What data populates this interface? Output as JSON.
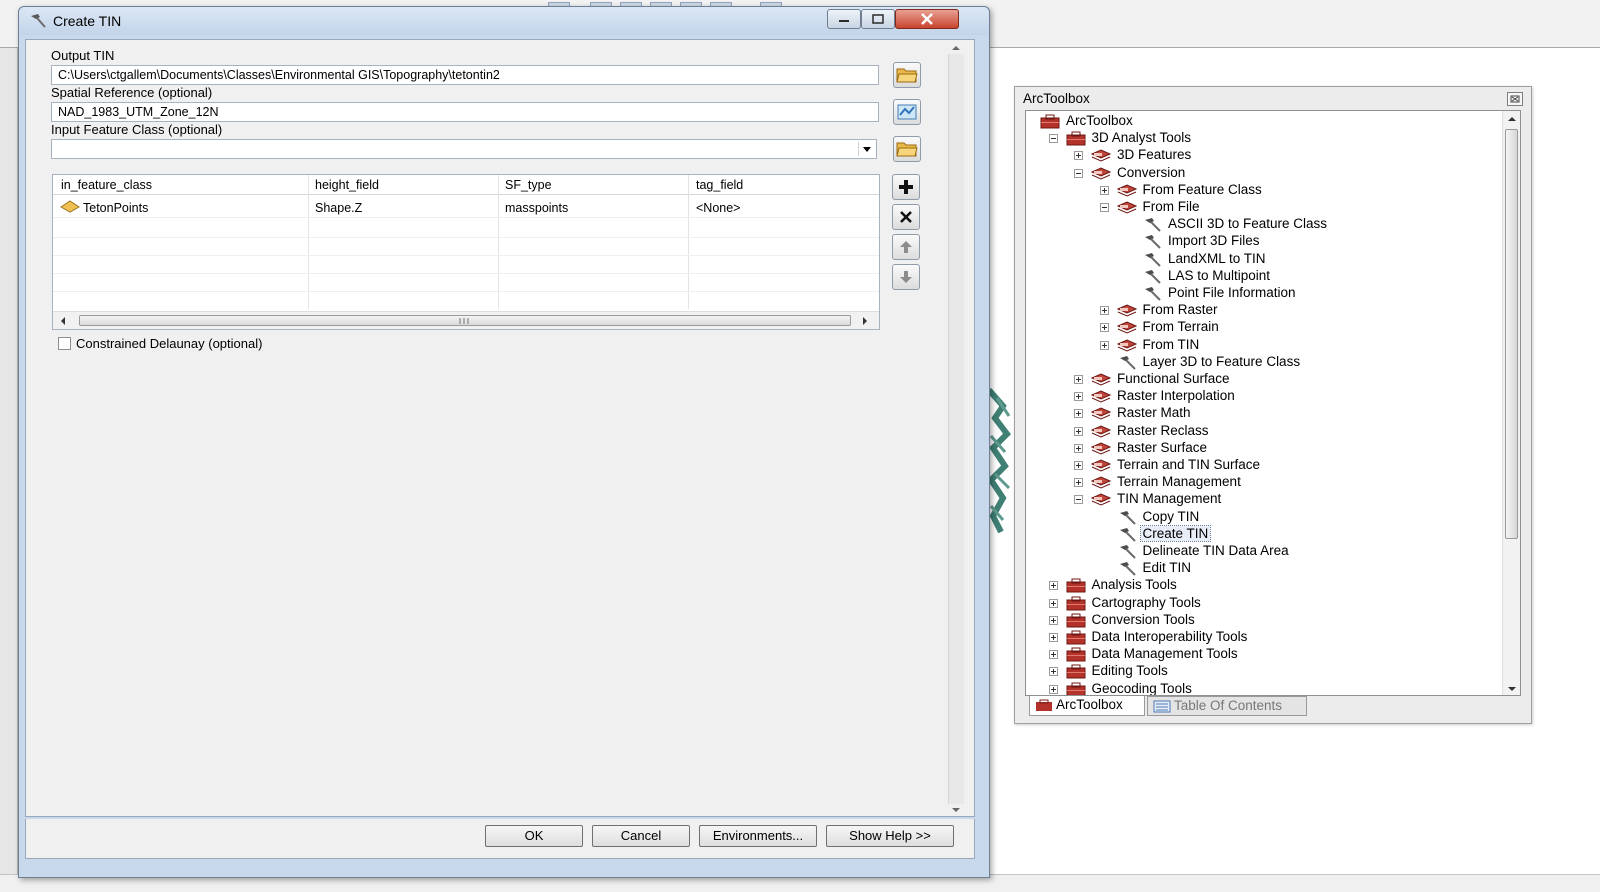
{
  "dialog": {
    "title": "Create TIN",
    "output_tin_label": "Output TIN",
    "output_tin_value": "C:\\Users\\ctgallem\\Documents\\Classes\\Environmental GIS\\Topography\\tetontin2",
    "spatial_ref_label": "Spatial Reference (optional)",
    "spatial_ref_value": "NAD_1983_UTM_Zone_12N",
    "input_fc_label": "Input Feature Class (optional)",
    "input_fc_value": "",
    "table": {
      "headers": [
        "in_feature_class",
        "height_field",
        "SF_type",
        "tag_field"
      ],
      "rows": [
        [
          "TetonPoints",
          "Shape.Z",
          "masspoints",
          "<None>"
        ]
      ]
    },
    "constrained_delaunay_label": "Constrained Delaunay (optional)",
    "constrained_delaunay_checked": false,
    "buttons": {
      "ok": "OK",
      "cancel": "Cancel",
      "environments": "Environments...",
      "show_help": "Show Help >>"
    }
  },
  "toolbox": {
    "title": "ArcToolbox",
    "tree": [
      {
        "label": "ArcToolbox",
        "level": 0,
        "icon": "toolbox-icon",
        "expander": "none"
      },
      {
        "label": "3D Analyst Tools",
        "level": 1,
        "icon": "toolbox-icon",
        "expander": "minus"
      },
      {
        "label": "3D Features",
        "level": 2,
        "icon": "toolset-icon",
        "expander": "plus"
      },
      {
        "label": "Conversion",
        "level": 2,
        "icon": "toolset-icon",
        "expander": "minus"
      },
      {
        "label": "From Feature Class",
        "level": 3,
        "icon": "toolset-icon",
        "expander": "plus"
      },
      {
        "label": "From File",
        "level": 3,
        "icon": "toolset-icon",
        "expander": "minus"
      },
      {
        "label": "ASCII 3D to Feature Class",
        "level": 4,
        "icon": "hammer-icon",
        "expander": "none"
      },
      {
        "label": "Import 3D Files",
        "level": 4,
        "icon": "hammer-icon",
        "expander": "none"
      },
      {
        "label": "LandXML to TIN",
        "level": 4,
        "icon": "hammer-icon",
        "expander": "none"
      },
      {
        "label": "LAS to Multipoint",
        "level": 4,
        "icon": "hammer-icon",
        "expander": "none"
      },
      {
        "label": "Point File Information",
        "level": 4,
        "icon": "hammer-icon",
        "expander": "none"
      },
      {
        "label": "From Raster",
        "level": 3,
        "icon": "toolset-icon",
        "expander": "plus"
      },
      {
        "label": "From Terrain",
        "level": 3,
        "icon": "toolset-icon",
        "expander": "plus"
      },
      {
        "label": "From TIN",
        "level": 3,
        "icon": "toolset-icon",
        "expander": "plus"
      },
      {
        "label": "Layer 3D to Feature Class",
        "level": 3,
        "icon": "hammer-icon",
        "expander": "none"
      },
      {
        "label": "Functional Surface",
        "level": 2,
        "icon": "toolset-icon",
        "expander": "plus"
      },
      {
        "label": "Raster Interpolation",
        "level": 2,
        "icon": "toolset-icon",
        "expander": "plus"
      },
      {
        "label": "Raster Math",
        "level": 2,
        "icon": "toolset-icon",
        "expander": "plus"
      },
      {
        "label": "Raster Reclass",
        "level": 2,
        "icon": "toolset-icon",
        "expander": "plus"
      },
      {
        "label": "Raster Surface",
        "level": 2,
        "icon": "toolset-icon",
        "expander": "plus"
      },
      {
        "label": "Terrain and TIN Surface",
        "level": 2,
        "icon": "toolset-icon",
        "expander": "plus"
      },
      {
        "label": "Terrain Management",
        "level": 2,
        "icon": "toolset-icon",
        "expander": "plus"
      },
      {
        "label": "TIN Management",
        "level": 2,
        "icon": "toolset-icon",
        "expander": "minus"
      },
      {
        "label": "Copy TIN",
        "level": 3,
        "icon": "hammer-icon",
        "expander": "none"
      },
      {
        "label": "Create TIN",
        "level": 3,
        "icon": "hammer-icon",
        "expander": "none",
        "selected": true
      },
      {
        "label": "Delineate TIN Data Area",
        "level": 3,
        "icon": "hammer-icon",
        "expander": "none"
      },
      {
        "label": "Edit TIN",
        "level": 3,
        "icon": "hammer-icon",
        "expander": "none"
      },
      {
        "label": "Analysis Tools",
        "level": 1,
        "icon": "toolbox-icon",
        "expander": "plus"
      },
      {
        "label": "Cartography Tools",
        "level": 1,
        "icon": "toolbox-icon",
        "expander": "plus"
      },
      {
        "label": "Conversion Tools",
        "level": 1,
        "icon": "toolbox-icon",
        "expander": "plus"
      },
      {
        "label": "Data Interoperability Tools",
        "level": 1,
        "icon": "toolbox-icon",
        "expander": "plus"
      },
      {
        "label": "Data Management Tools",
        "level": 1,
        "icon": "toolbox-icon",
        "expander": "plus"
      },
      {
        "label": "Editing Tools",
        "level": 1,
        "icon": "toolbox-icon",
        "expander": "plus"
      },
      {
        "label": "Geocoding Tools",
        "level": 1,
        "icon": "toolbox-icon",
        "expander": "plus"
      }
    ],
    "tabs": [
      "ArcToolbox",
      "Table Of Contents"
    ]
  },
  "colors": {
    "toolbox_red": "#b3322a",
    "toolset_red": "#c0463c",
    "selection_blue": "#3d6fb6"
  }
}
